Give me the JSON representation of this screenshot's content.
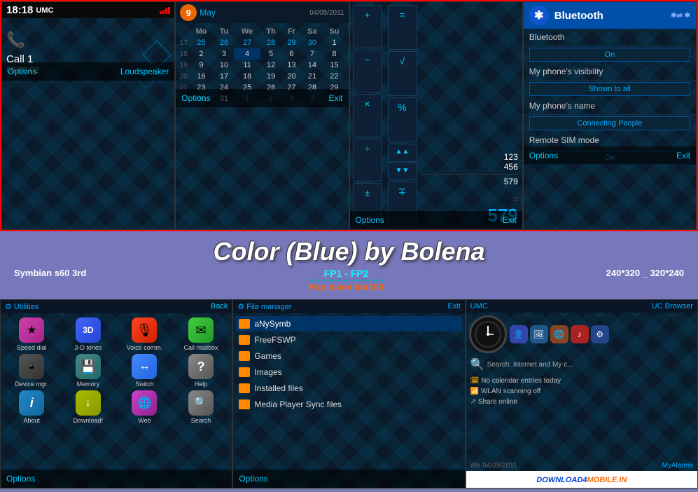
{
  "screen1": {
    "time": "18:18",
    "operator": "UMC",
    "call_name": "Call 1",
    "call_duration": "00:00:02",
    "options_label": "Options",
    "loudspeaker_label": "Loudspeaker"
  },
  "screen2": {
    "month": "May",
    "date": "04/05/2011",
    "days": [
      "Mo",
      "Tu",
      "We",
      "Th",
      "Fr",
      "Sa",
      "Su"
    ],
    "weeks": [
      [
        "17",
        "25",
        "26",
        "27",
        "28",
        "29",
        "30",
        "1"
      ],
      [
        "18",
        "2",
        "3",
        "4",
        "5",
        "6",
        "7",
        "8"
      ],
      [
        "19",
        "9",
        "10",
        "11",
        "12",
        "13",
        "14",
        "15"
      ],
      [
        "20",
        "16",
        "17",
        "18",
        "19",
        "20",
        "21",
        "22"
      ],
      [
        "21",
        "23",
        "24",
        "25",
        "26",
        "27",
        "28",
        "29"
      ],
      [
        "22",
        "30",
        "31",
        "1",
        "2",
        "3",
        "4",
        "5"
      ]
    ],
    "options_label": "Options",
    "exit_label": "Exit"
  },
  "screen3": {
    "buttons_row1": [
      "+",
      "="
    ],
    "buttons_row2": [
      "-",
      "√"
    ],
    "buttons_row3": [
      "×",
      "%"
    ],
    "buttons_row4": [
      "÷",
      "↑↑"
    ],
    "buttons_row5": [
      "±",
      "↓↓"
    ],
    "display_nums": [
      "123",
      "456",
      "579"
    ],
    "operator_signs": [
      "+",
      "="
    ],
    "result": "579",
    "big_result": "579",
    "options_label": "Options",
    "exit_label": "Exit"
  },
  "screen4": {
    "title": "Bluetooth",
    "bluetooth_label": "Bluetooth",
    "bluetooth_value": "On",
    "visibility_label": "My phone's visibility",
    "visibility_value": "Shown to all",
    "name_label": "My phone's name",
    "name_value": "Connecting People",
    "sim_label": "Remote SIM mode",
    "sim_value": "On",
    "options_label": "Options",
    "exit_label": "Exit"
  },
  "title_section": {
    "main_title": "Color (Blue) by Bolena",
    "left_label": "Symbian s60 3rd",
    "center_label": "FP1 - FP2",
    "center_sub": "Pop Icons Ind190",
    "right_label": "240*320 _ 320*240"
  },
  "screen5": {
    "title": "Utilities",
    "back_label": "Back",
    "apps": [
      {
        "label": "Speed dial",
        "icon": "★"
      },
      {
        "label": "3-D tones",
        "icon": "3D"
      },
      {
        "label": "Voice comm.",
        "icon": "♪"
      },
      {
        "label": "Call mailbox",
        "icon": "✉"
      },
      {
        "label": "Device mgr.",
        "icon": "⚙"
      },
      {
        "label": "Memory",
        "icon": "💾"
      },
      {
        "label": "Switch",
        "icon": "↔"
      },
      {
        "label": "Help",
        "icon": "?"
      },
      {
        "label": "About",
        "icon": "i"
      },
      {
        "label": "Download!",
        "icon": "↓"
      },
      {
        "label": "Web",
        "icon": "🌐"
      },
      {
        "label": "Search",
        "icon": "🔍"
      }
    ],
    "options_label": "Options"
  },
  "screen6": {
    "title": "File manager",
    "exit_label": "Exit",
    "files": [
      {
        "name": "aNySymb",
        "selected": true
      },
      {
        "name": "FreeFSWP",
        "selected": false
      },
      {
        "name": "Games",
        "selected": false
      },
      {
        "name": "Images",
        "selected": false
      },
      {
        "name": "Installed files",
        "selected": false
      },
      {
        "name": "Media Player Sync files",
        "selected": false
      }
    ],
    "options_label": "Options"
  },
  "screen7": {
    "operator": "UMC",
    "browser": "UC Browser",
    "search_text": "Search: Internet and My c...",
    "calendar_text": "No calendar entries today",
    "wlan_text": "WLAN scanning off",
    "share_text": "Share online",
    "date_text": "We 04/05/2011",
    "myalarms_text": "MyAlarms",
    "download_badge": "DOWNLOAD4MOBILE.IN"
  }
}
